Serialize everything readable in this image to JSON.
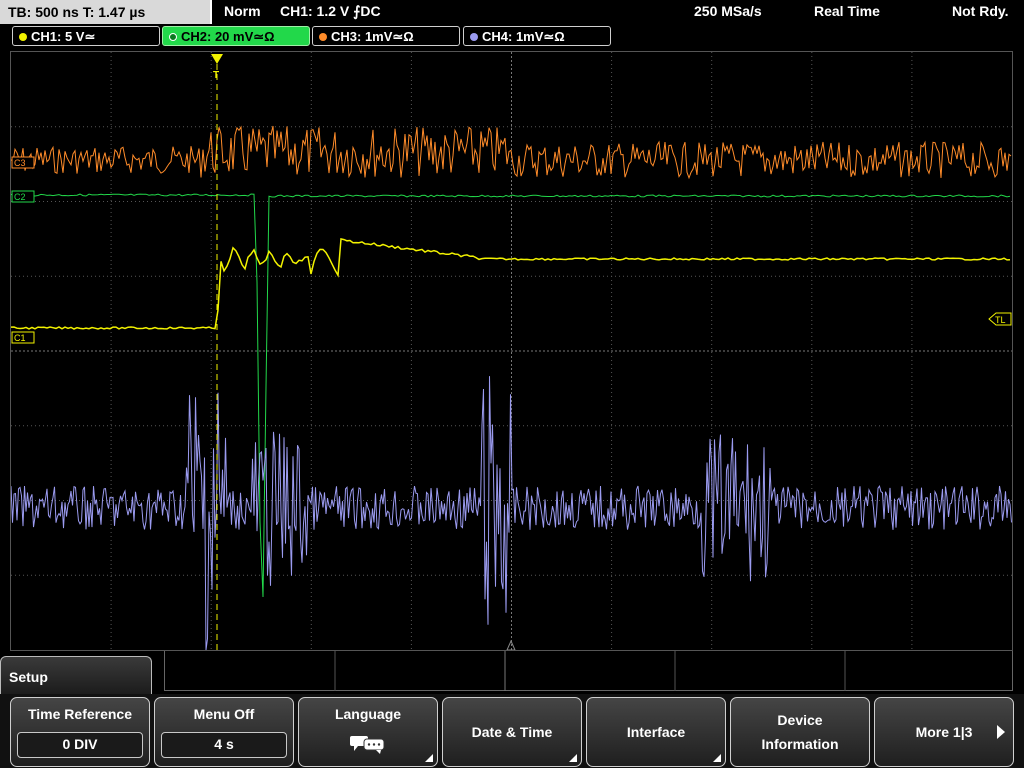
{
  "status_bar": {
    "timebase": "TB: 500 ns   T: 1.47 µs",
    "trigger_mode": "Norm",
    "trigger_info": "CH1: 1.2 V ⨍DC",
    "sample_rate": "250 MSa/s",
    "acq_mode": "Real Time",
    "run_state": "Not Rdy."
  },
  "channels": [
    {
      "label": "CH1: 5 V≃",
      "color": "#f2f200",
      "active": false
    },
    {
      "label": "CH2: 20 mV≃Ω",
      "color": "#22d84a",
      "active": true
    },
    {
      "label": "CH3: 1mV≃Ω",
      "color": "#ff8c2a",
      "active": false
    },
    {
      "label": "CH4: 1mV≃Ω",
      "color": "#9b9bf0",
      "active": false
    }
  ],
  "trace_markers": {
    "c1": "C1",
    "c2": "C2",
    "c3": "C3",
    "trigger_level": "TL",
    "trigger_point": "T"
  },
  "menu": {
    "title": "Setup",
    "softkeys": [
      {
        "label": "Time Reference",
        "value": "0 DIV"
      },
      {
        "label": "Menu Off",
        "value": "4 s"
      },
      {
        "label": "Language",
        "icon": "speech-bubble-icon"
      },
      {
        "label": "Date & Time"
      },
      {
        "label": "Interface"
      },
      {
        "label": "Device Information"
      },
      {
        "label": "More 1|3"
      }
    ]
  },
  "colors": {
    "ch1": "#f2f200",
    "ch2": "#22d84a",
    "ch3": "#ff8c2a",
    "ch4": "#9b9bf0",
    "grid": "#555555"
  }
}
